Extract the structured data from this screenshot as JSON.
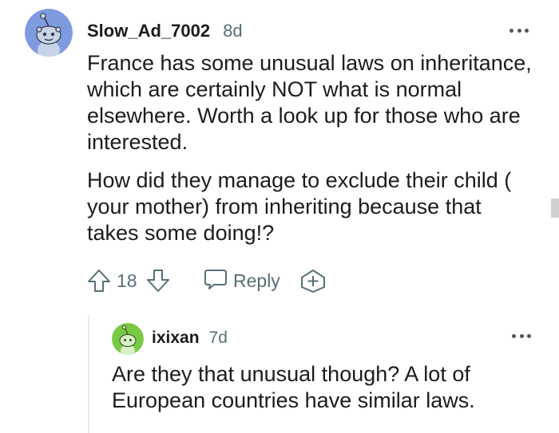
{
  "comment": {
    "username": "Slow_Ad_7002",
    "age": "8d",
    "avatar_icon": "snoo-avatar-icon",
    "avatar_color": "#6f8fdc",
    "paragraphs": [
      "France has some unusual laws on inheritance, which are certainly NOT what is normal elsewhere. Worth a look up for those who are interested.",
      "How did they manage to exclude their child ( your mother) from inheriting because that takes some doing!?"
    ],
    "more_icon": "more-options-icon"
  },
  "actions": {
    "upvote_icon": "upvote-arrow-icon",
    "vote_count": "18",
    "downvote_icon": "downvote-arrow-icon",
    "reply_icon": "speech-bubble-icon",
    "reply_label": "Reply",
    "award_icon": "award-plus-icon"
  },
  "reply": {
    "username": "ixixan",
    "age": "7d",
    "avatar_icon": "snoo-avatar-icon",
    "avatar_color": "#7ac943",
    "text": "Are they that unusual though? A lot of European countries have similar laws.",
    "more_icon": "more-options-icon"
  },
  "colors": {
    "text": "#1c1c1c",
    "meta": "#576f76",
    "threadline": "#e5ebee"
  }
}
